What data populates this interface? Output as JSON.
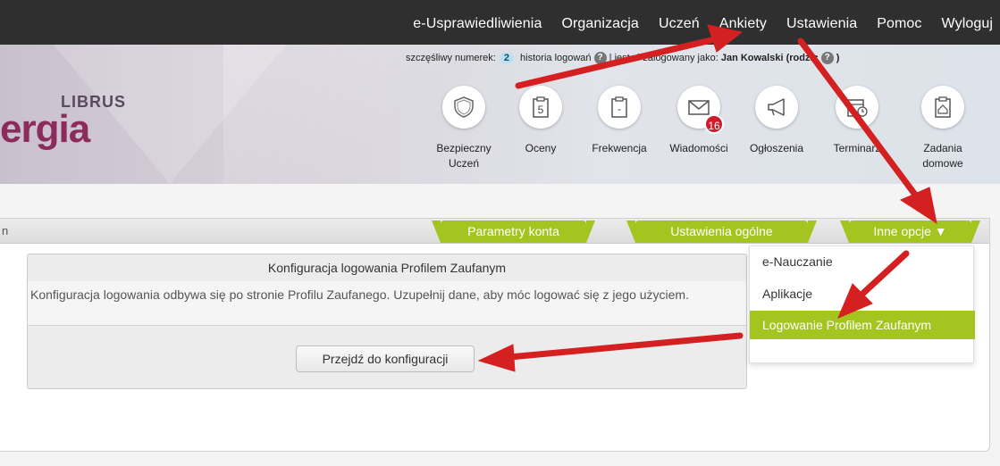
{
  "nav": {
    "items": [
      "e-Usprawiedliwienia",
      "Organizacja",
      "Uczeń",
      "Ankiety",
      "Ustawienia",
      "Pomoc",
      "Wyloguj"
    ]
  },
  "logo": {
    "small": "LIBRUS",
    "big": "ergia"
  },
  "info": {
    "lucky_label": "szczęśliwy numerek:",
    "lucky_number": "2",
    "history_label": "historia logowań",
    "logged_prefix": "| jesteś zalogowany jako:",
    "user_name": "Jan Kowalski (rodzic",
    "close_paren": ")"
  },
  "tiles": [
    {
      "label": "Bezpieczny Uczeń",
      "icon": "shield-icon"
    },
    {
      "label": "Oceny",
      "icon": "grades-icon",
      "glyph": "5"
    },
    {
      "label": "Frekwencja",
      "icon": "attendance-icon",
      "glyph": "-"
    },
    {
      "label": "Wiadomości",
      "icon": "envelope-icon",
      "badge": "16"
    },
    {
      "label": "Ogłoszenia",
      "icon": "megaphone-icon"
    },
    {
      "label": "Terminarz",
      "icon": "calendar-icon"
    },
    {
      "label": "Zadania domowe",
      "icon": "homework-icon"
    }
  ],
  "panel": {
    "title_fragment": "n",
    "tabs": [
      "Parametry konta",
      "Ustawienia ogólne",
      "Inne opcje ▼"
    ]
  },
  "dropdown": {
    "items": [
      "e-Nauczanie",
      "Aplikacje",
      "Logowanie Profilem Zaufanym"
    ],
    "active_index": 2
  },
  "config": {
    "title": "Konfiguracja logowania Profilem Zaufanym",
    "description": "Konfiguracja logowania odbywa się po stronie Profilu Zaufanego. Uzupełnij dane, aby móc logować się z jego użyciem.",
    "button": "Przejdź do konfiguracji"
  },
  "colors": {
    "accent": "#a4c51f",
    "topbar": "#2f2f2f",
    "badge": "#d11a2a",
    "annotation_arrow": "#d42020",
    "logo": "#8c2c5c"
  }
}
